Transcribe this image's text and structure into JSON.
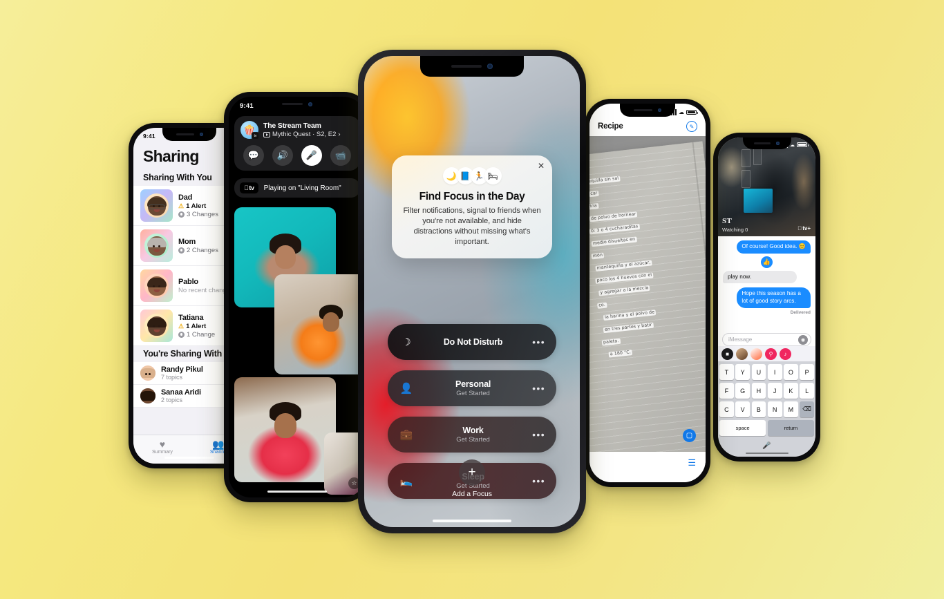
{
  "background": {
    "color_top_left": "#f5e87f",
    "color_bottom_right": "#f1ef9e"
  },
  "phone_sharing": {
    "name": "Find My Sharing",
    "status_time": "9:41",
    "title": "Sharing",
    "section_with_you": "Sharing With You",
    "section_you_share": "You're Sharing With",
    "sharing_with_you": [
      {
        "name": "Dad",
        "alert": "1 Alert",
        "changes": "3 Changes"
      },
      {
        "name": "Mom",
        "alert": "",
        "changes": "2 Changes"
      },
      {
        "name": "Pablo",
        "alert": "",
        "changes": "No recent changes"
      },
      {
        "name": "Tatiana",
        "alert": "1 Alert",
        "changes": "1 Change"
      }
    ],
    "you_sharing_with": [
      {
        "name": "Randy Pikul",
        "topics": "7 topics"
      },
      {
        "name": "Sanaa Aridi",
        "topics": "2 topics"
      }
    ],
    "tabs": [
      {
        "label": "Summary",
        "icon": "heart-icon",
        "active": false
      },
      {
        "label": "Sharing",
        "icon": "people-icon",
        "active": true
      }
    ]
  },
  "phone_facetime": {
    "name": "FaceTime SharePlay",
    "status_time": "9:41",
    "group_title": "The Stream Team",
    "media_title": "Mythic Quest · S2, E2",
    "now_playing": "Playing on \"Living Room\"",
    "atv_label": "tv",
    "controls": [
      {
        "icon": "chat-bubble-icon",
        "active": false
      },
      {
        "icon": "speaker-icon",
        "active": false
      },
      {
        "icon": "microphone-icon",
        "active": true
      },
      {
        "icon": "video-camera-icon",
        "active": false
      }
    ]
  },
  "phone_focus": {
    "name": "Focus setup",
    "card": {
      "close_icon": "close-icon",
      "icons": [
        "crescent-moon-icon",
        "book-icon",
        "running-person-icon",
        "bed-icon"
      ],
      "icon_glyphs": [
        "🌙",
        "📘",
        "🏃",
        "🛏"
      ],
      "title": "Find Focus in the Day",
      "description": "Filter notifications, signal to friends when you're not available, and hide distractions without missing what's important."
    },
    "modes": [
      {
        "name": "Do Not Disturb",
        "subtitle": "",
        "icon": "crescent-moon-icon",
        "glyph": "☽",
        "more": "•••"
      },
      {
        "name": "Personal",
        "subtitle": "Get Started",
        "icon": "person-icon",
        "glyph": "●",
        "more": "•••"
      },
      {
        "name": "Work",
        "subtitle": "Get Started",
        "icon": "id-badge-icon",
        "glyph": "▣",
        "more": "•••"
      },
      {
        "name": "Sleep",
        "subtitle": "Get Started",
        "icon": "bed-icon",
        "glyph": "☷",
        "more": "•••"
      }
    ],
    "add_focus": {
      "label": "Add a Focus",
      "icon": "plus-icon",
      "glyph": "+"
    }
  },
  "phone_notes": {
    "name": "Notes Live Text",
    "title": "Recipe",
    "markup_icon": "markup-pen-icon",
    "scan_icon": "live-text-scan-icon",
    "list_icon": "checklist-icon",
    "note_lines": [
      "tequilla sin sal",
      "car",
      "rina",
      "de polvo de hornear",
      "0: 3 o 4 cucharaditas",
      "medio disueltas en",
      "món",
      "mantequilla y el azúcar,",
      "poco los 4 huevos con el",
      "y agregar a la mezcla",
      "co.",
      "la harina y el polvo de",
      "en tres partes y batir",
      "paleta.",
      "a 180 °C."
    ]
  },
  "phone_messages": {
    "name": "Messages with Shared with You",
    "video_title": "ST",
    "video_sub": "Watching 0",
    "atv_badge": "tv+",
    "messages": [
      {
        "side": "out",
        "text": "Of course! Good idea. 😊"
      },
      {
        "side": "tapback",
        "text": "👍"
      },
      {
        "side": "in",
        "text": "play now."
      },
      {
        "side": "out",
        "text": "Hope this season has a lot of good story arcs."
      }
    ],
    "delivered": "Delivered",
    "input_placeholder": "iMessage",
    "audio_icon": "audio-wave-icon",
    "app_icons": [
      "photos-icon",
      "memoji-icon",
      "stickers-icon",
      "gif-search-icon",
      "music-icon"
    ],
    "keyboard": {
      "row1": [
        "T",
        "Y",
        "U",
        "I",
        "O",
        "P"
      ],
      "row2": [
        "F",
        "G",
        "H",
        "J",
        "K",
        "L"
      ],
      "row3": [
        "C",
        "V",
        "B",
        "N",
        "M"
      ],
      "delete_icon": "delete-key-icon",
      "space": "space",
      "return": "return",
      "mic_icon": "microphone-icon"
    }
  }
}
